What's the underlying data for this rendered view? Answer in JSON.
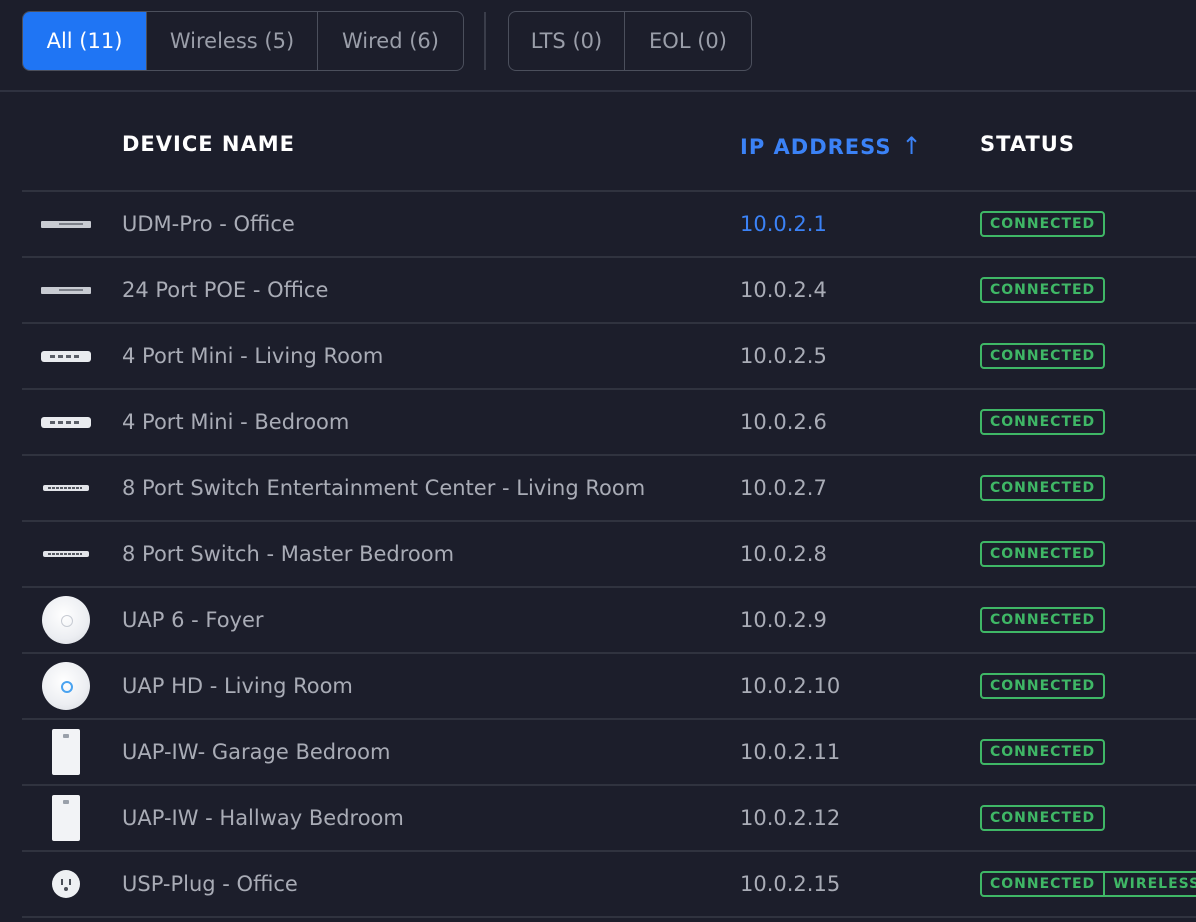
{
  "filters": {
    "type_group": [
      {
        "label": "All (11)",
        "active": true
      },
      {
        "label": "Wireless (5)",
        "active": false
      },
      {
        "label": "Wired (6)",
        "active": false
      }
    ],
    "support_group": [
      {
        "label": "LTS (0)",
        "active": false
      },
      {
        "label": "EOL (0)",
        "active": false
      }
    ]
  },
  "table": {
    "headers": {
      "device_name": "DEVICE NAME",
      "ip_address": "IP ADDRESS",
      "ip_sort_arrow": "↑",
      "status": "STATUS"
    },
    "rows": [
      {
        "icon": "rack-gateway-icon",
        "name": "UDM-Pro - Office",
        "ip": "10.0.2.1",
        "status": [
          "CONNECTED"
        ]
      },
      {
        "icon": "rack-switch-icon",
        "name": "24 Port POE - Office",
        "ip": "10.0.2.4",
        "status": [
          "CONNECTED"
        ]
      },
      {
        "icon": "mini-switch-icon",
        "name": "4 Port Mini - Living Room",
        "ip": "10.0.2.5",
        "status": [
          "CONNECTED"
        ]
      },
      {
        "icon": "mini-switch-icon",
        "name": "4 Port Mini - Bedroom",
        "ip": "10.0.2.6",
        "status": [
          "CONNECTED"
        ]
      },
      {
        "icon": "switch-8-icon",
        "name": "8 Port Switch Entertainment Center - Living Room",
        "ip": "10.0.2.7",
        "status": [
          "CONNECTED"
        ]
      },
      {
        "icon": "switch-8-icon",
        "name": "8 Port Switch - Master Bedroom",
        "ip": "10.0.2.8",
        "status": [
          "CONNECTED"
        ]
      },
      {
        "icon": "access-point-disc-icon",
        "name": "UAP 6 - Foyer",
        "ip": "10.0.2.9",
        "status": [
          "CONNECTED"
        ]
      },
      {
        "icon": "access-point-hd-icon",
        "name": "UAP HD - Living Room",
        "ip": "10.0.2.10",
        "status": [
          "CONNECTED"
        ]
      },
      {
        "icon": "in-wall-ap-icon",
        "name": "UAP-IW- Garage Bedroom",
        "ip": "10.0.2.11",
        "status": [
          "CONNECTED"
        ]
      },
      {
        "icon": "in-wall-ap-icon",
        "name": "UAP-IW - Hallway Bedroom",
        "ip": "10.0.2.12",
        "status": [
          "CONNECTED"
        ]
      },
      {
        "icon": "smart-plug-icon",
        "name": "USP-Plug - Office",
        "ip": "10.0.2.15",
        "status": [
          "CONNECTED",
          "WIRELESS"
        ]
      }
    ]
  },
  "colors": {
    "accent": "#1f75f4",
    "link": "#3b82f6",
    "status_ok": "#3fb766",
    "background": "#1c1e2b"
  }
}
